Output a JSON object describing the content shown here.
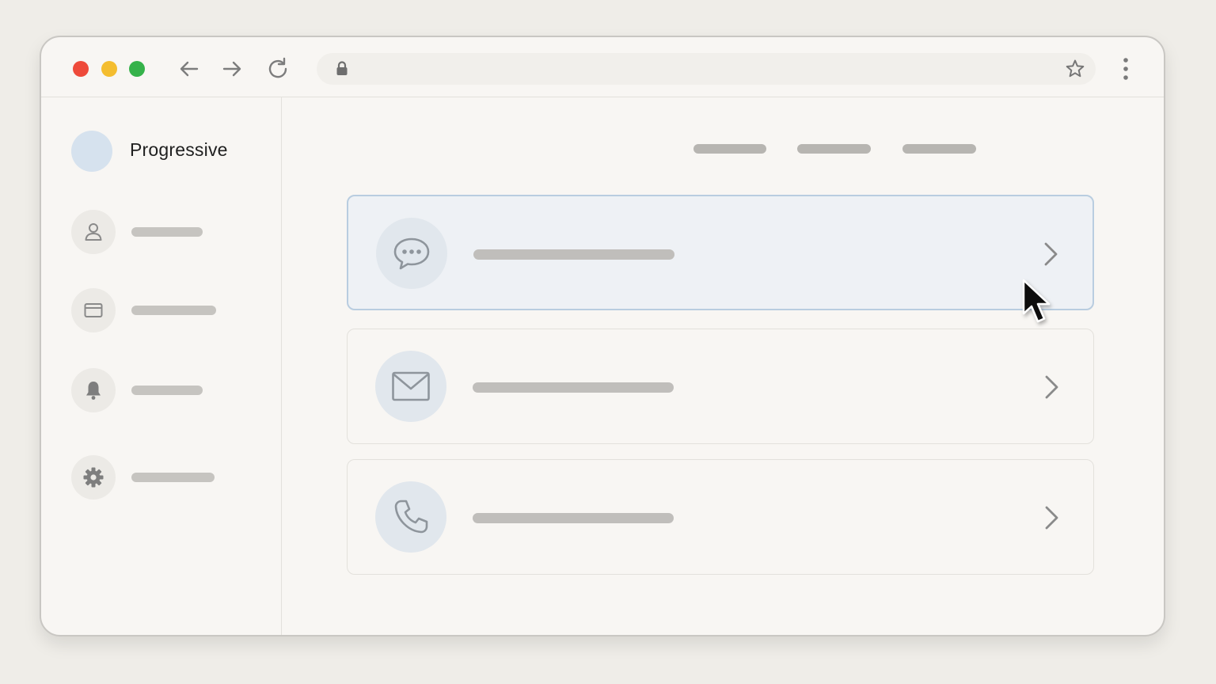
{
  "window": {
    "controls": {
      "close_color": "#ee4a3a",
      "minimize_color": "#f4bd2f",
      "maximize_color": "#35b24a"
    },
    "toolbar": {
      "back_icon": "arrow-left-icon",
      "forward_icon": "arrow-right-icon",
      "reload_icon": "reload-icon",
      "lock_icon": "lock-icon",
      "bookmark_icon": "star-icon",
      "menu_icon": "kebab-menu-icon",
      "url": ""
    }
  },
  "sidebar": {
    "brand": {
      "name": "Progressive",
      "avatar_color": "#d6e2ee"
    },
    "items": [
      {
        "icon": "user-icon",
        "label": ""
      },
      {
        "icon": "card-icon",
        "label": ""
      },
      {
        "icon": "bell-icon",
        "label": ""
      },
      {
        "icon": "gear-icon",
        "label": ""
      }
    ]
  },
  "main": {
    "top_nav": [
      "",
      "",
      ""
    ],
    "options": [
      {
        "icon": "chat-bubble-icon",
        "label": "",
        "selected": true
      },
      {
        "icon": "envelope-icon",
        "label": "",
        "selected": false
      },
      {
        "icon": "phone-icon",
        "label": "",
        "selected": false
      }
    ]
  },
  "colors": {
    "selected_border": "#b9cde0",
    "selected_background": "#eef1f5",
    "icon_stroke": "#8e959c"
  }
}
